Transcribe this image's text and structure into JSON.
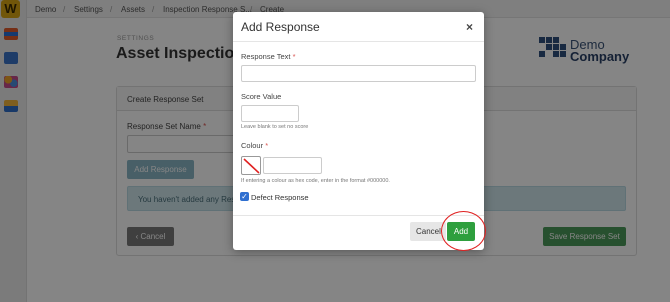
{
  "breadcrumb": [
    "Demo",
    "Settings",
    "Assets",
    "Inspection Response S...",
    "Create"
  ],
  "page": {
    "kicker": "SETTINGS",
    "title": "Asset Inspection Re"
  },
  "brand": {
    "line1": "Demo",
    "line2": "Company"
  },
  "logo_letter": "W",
  "card": {
    "header": "Create Response Set",
    "set_name_label": "Response Set Name",
    "required_mark": "*",
    "add_response_button": "Add Response",
    "info_text": "You haven't added any Respo",
    "cancel_button": "‹ Cancel",
    "save_button": "Save Response Set"
  },
  "modal": {
    "title": "Add Response",
    "close": "×",
    "response_text_label": "Response Text",
    "required_mark": "*",
    "response_text_value": "",
    "score_label": "Score Value",
    "score_value": "",
    "score_help": "Leave blank to set no score",
    "colour_label": "Colour",
    "colour_value": "",
    "colour_help": "If entering a colour as hex code, enter in the format #000000.",
    "defect_label": "Defect Response",
    "defect_checked": true,
    "cancel_button": "Cancel",
    "add_button": "Add"
  },
  "colors": {
    "primary_green": "#2e9f3e",
    "checkbox_blue": "#2f6fd0",
    "highlight_red": "#e02020"
  },
  "icons": [
    "app-logo-icon",
    "calendar-icon",
    "list-icon",
    "people-icon",
    "tools-icon",
    "close-icon",
    "checkmark-icon",
    "no-colour-icon"
  ]
}
